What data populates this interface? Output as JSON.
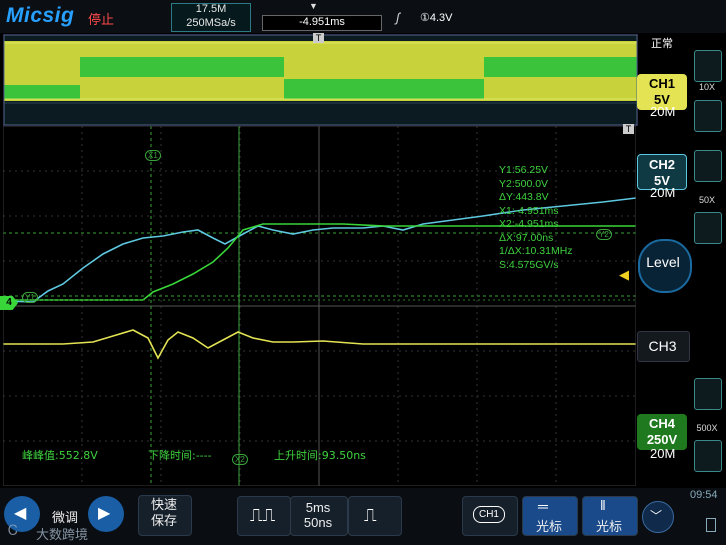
{
  "topbar": {
    "logo": "Micsig",
    "run_state": "停止",
    "memory_depth": "17.5M",
    "sample_rate": "250MSa/s",
    "time_position": "-4.951ms",
    "trigger_level": "①4.3V",
    "trigger_mode": "正常"
  },
  "channels": {
    "ch1": {
      "label": "CH1",
      "scale": "5V",
      "probe": "10X",
      "bandwidth": "20M",
      "color": "#e3e354"
    },
    "ch2": {
      "label": "CH2",
      "scale": "5V",
      "probe": "50X",
      "bandwidth": "20M",
      "color": "#5ec8e0"
    },
    "ch3": {
      "label": "CH3"
    },
    "ch4": {
      "label": "CH4",
      "scale": "250V",
      "probe": "500X",
      "bandwidth": "20M",
      "color": "#38d638"
    }
  },
  "level_button": "Level",
  "cursor_readout": {
    "y1": "Y1:56.25V",
    "y2": "Y2:500.0V",
    "dy": "ΔY:443.8V",
    "x1": "X1:-4.951ms",
    "x2": "X2:-4.951ms",
    "dx": "ΔX:97.00ns",
    "inv_dx": "1/ΔX:10.31MHz",
    "slew": "S:4.575GV/s"
  },
  "measurements": {
    "peak_to_peak": "峰峰值:552.8V",
    "fall_time": "下降时间:----",
    "rise_time": "上升时间:93.50ns"
  },
  "markers": {
    "x1": "X1",
    "x2": "X2",
    "y1": "Y1",
    "y2": "Y2",
    "ch4_ground": "4",
    "trigger": "T"
  },
  "bottombar": {
    "fine_adjust": "微调",
    "quick_save": "快速\n保存",
    "timebase_main": "5ms",
    "timebase_zoom": "50ns",
    "cursor_channel": "CH1",
    "cursor_h": "光标",
    "cursor_v": "光标",
    "watermark": "大数跨境",
    "clock": "09:54"
  }
}
